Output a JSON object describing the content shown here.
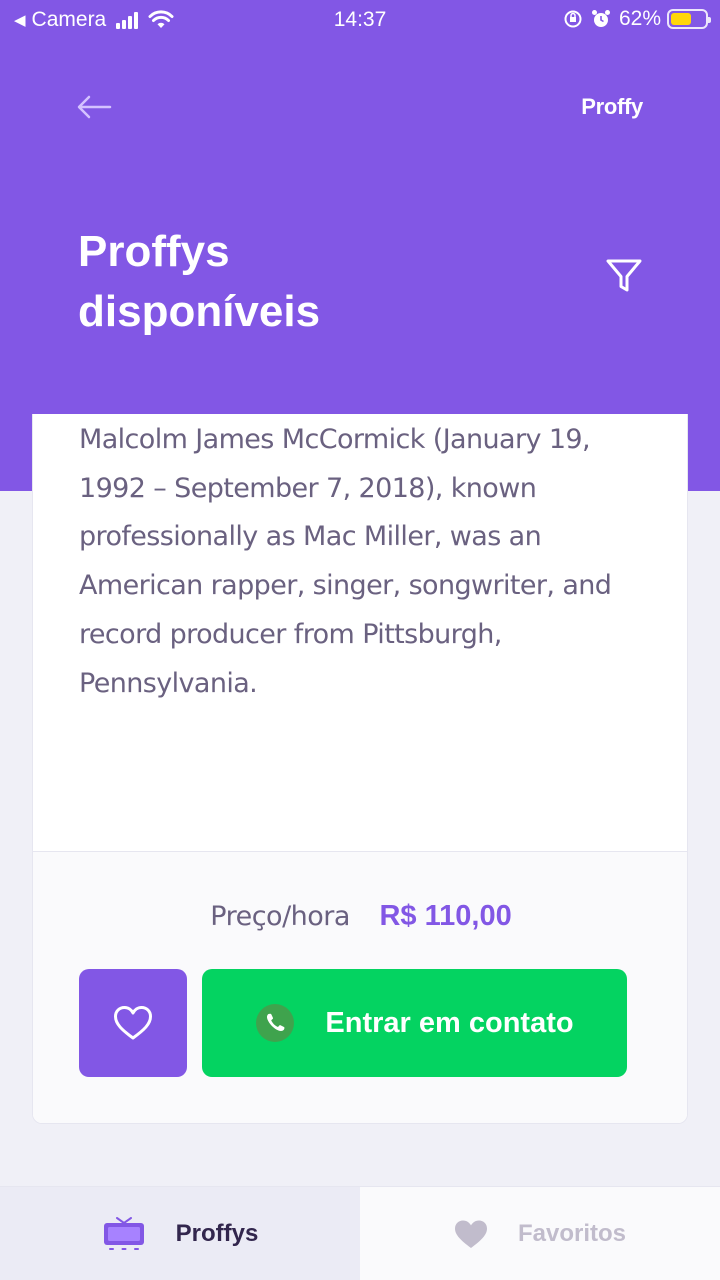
{
  "status_bar": {
    "carrier": "Camera",
    "time": "14:37",
    "battery_percent": "62%",
    "battery_level": 0.62
  },
  "header": {
    "brand": "Proffy",
    "title_line1": "Proffys",
    "title_line2": "disponíveis"
  },
  "teacher_card": {
    "bio": "Malcolm James McCormick (January 19, 1992 – September 7, 2018), known professionally as Mac Miller, was an American rapper, singer, songwriter, and record producer from Pittsburgh, Pennsylvania.",
    "price_label": "Preço/hora",
    "price_value": "R$ 110,00",
    "contact_label": "Entrar em contato"
  },
  "tabbar": {
    "tabs": [
      {
        "label": "Proffys",
        "icon": "tv-icon",
        "active": true
      },
      {
        "label": "Favoritos",
        "icon": "heart-icon",
        "active": false
      }
    ]
  },
  "colors": {
    "primary": "#8257E5",
    "secondary": "#04D361",
    "background": "#F0F0F7",
    "text_base": "#6A6180",
    "text_title": "#32264D"
  }
}
